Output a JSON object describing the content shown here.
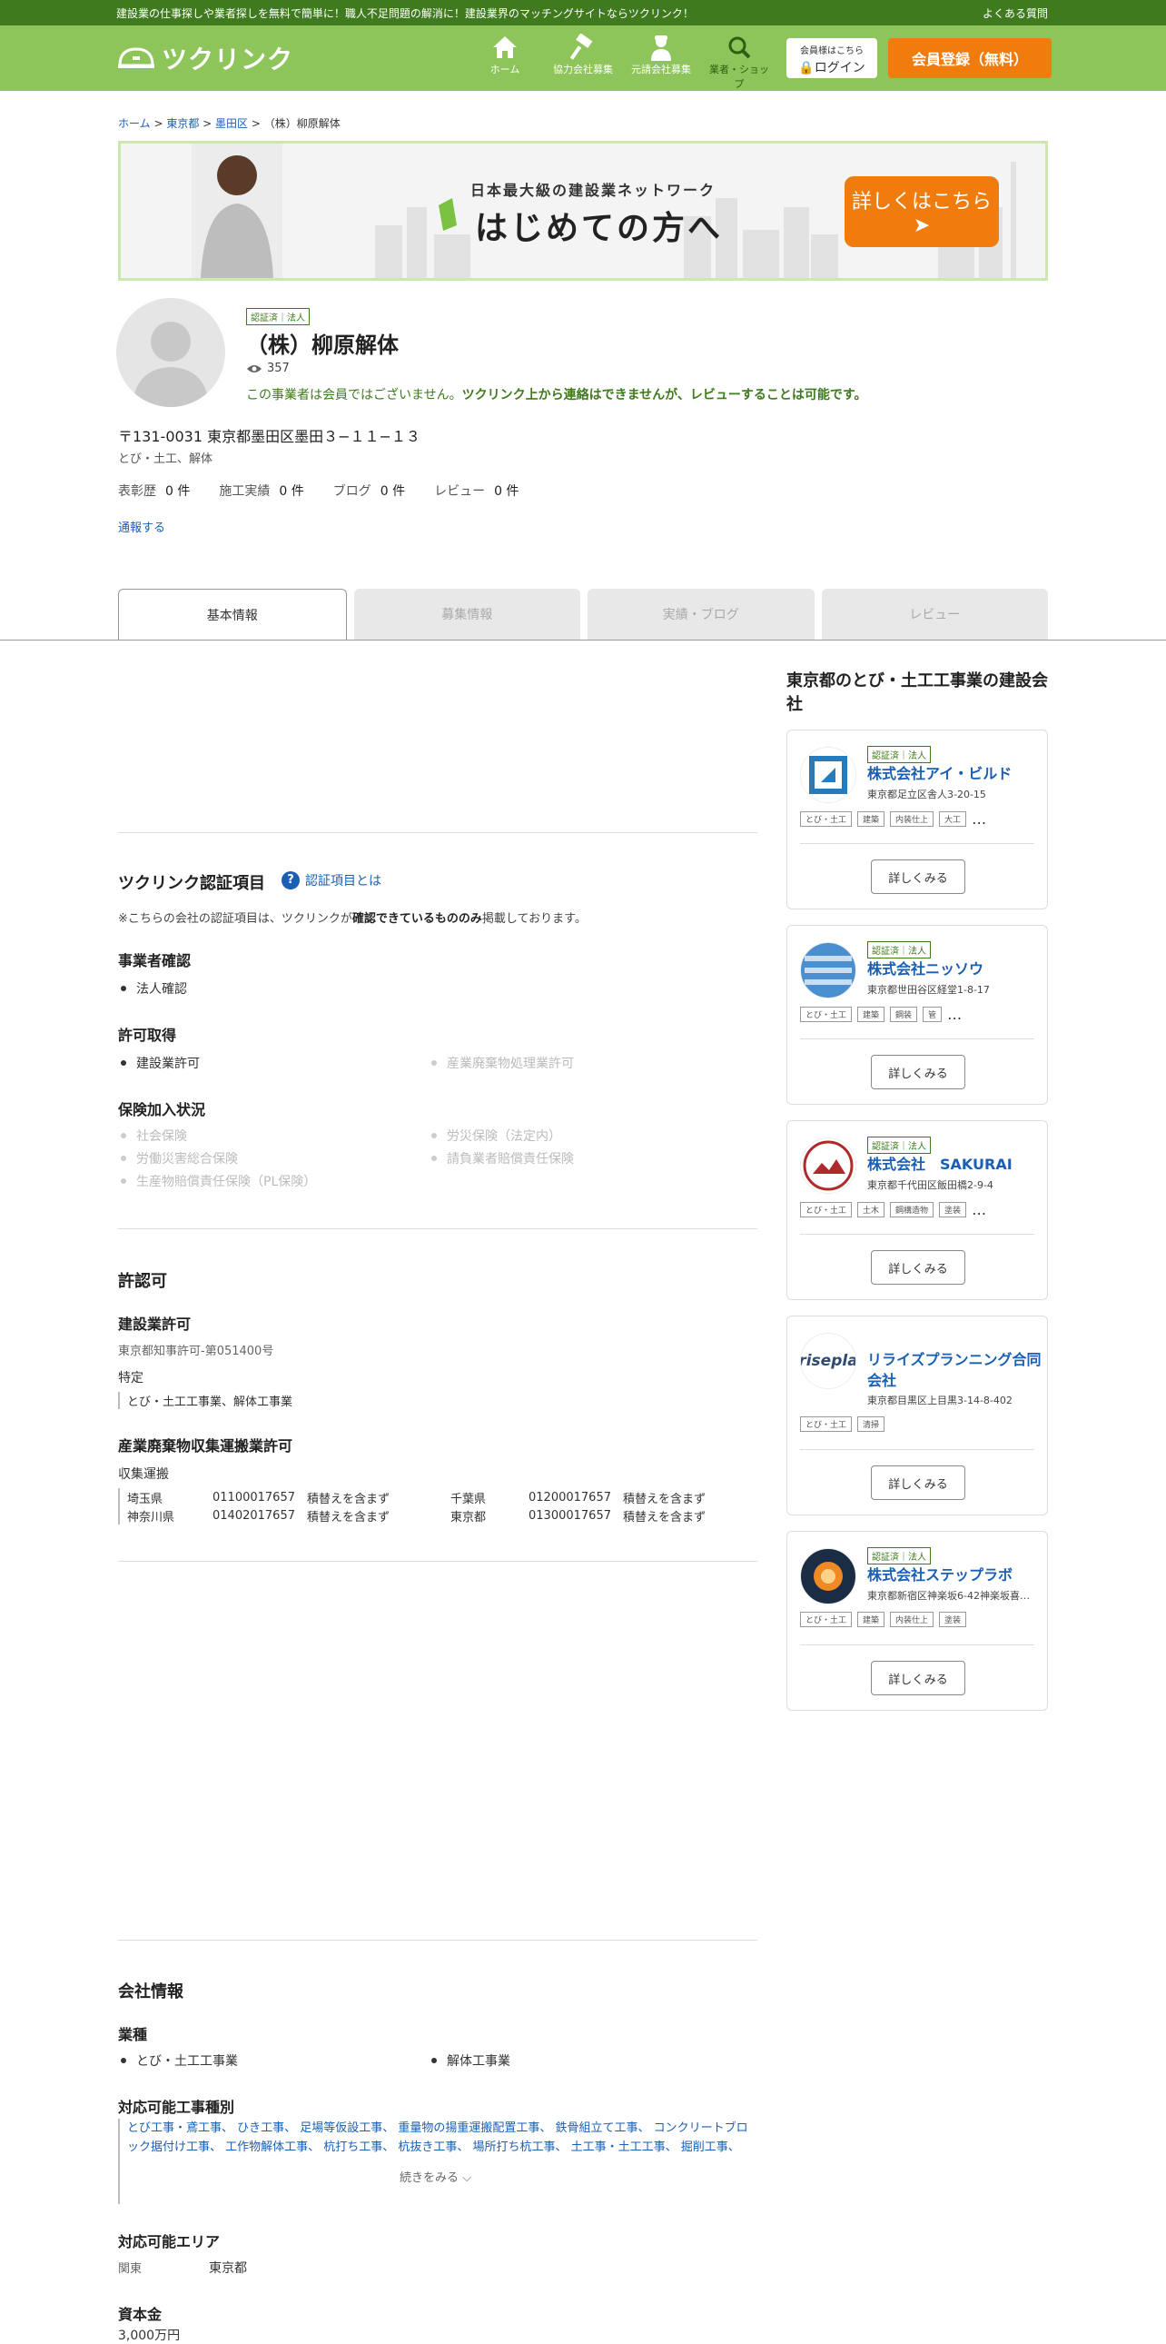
{
  "topbar": {
    "tagline": "建設業の仕事探しや業者探しを無料で簡単に！職人不足問題の解消に！建設業界のマッチングサイトならツクリンク！",
    "faq": "よくある質問"
  },
  "header": {
    "logo": "ツクリンク",
    "nav": [
      {
        "label": "ホーム",
        "icon": "home-icon"
      },
      {
        "label": "協力会社募集",
        "icon": "hammer-icon"
      },
      {
        "label": "元請会社募集",
        "icon": "worker-icon"
      },
      {
        "label": "業者・ショップ",
        "icon": "search-icon"
      }
    ],
    "login_top": "会員様はこちら",
    "login": "ログイン",
    "register": "会員登録（無料）"
  },
  "breadcrumb": {
    "home": "ホーム",
    "pref": "東京都",
    "city": "墨田区",
    "current": "（株）柳原解体"
  },
  "banner": {
    "sub": "日本最大級の建設業ネットワーク",
    "main": "はじめての方へ",
    "cta": "詳しくはこちら"
  },
  "company": {
    "badge": "認証済｜法人",
    "name": "（株）柳原解体",
    "views": "357",
    "notice_a": "この事業者は会員ではございません。",
    "notice_b": "ツクリンク上から連絡はできませんが、レビューすることは可能です。",
    "address": "〒131-0031 東京都墨田区墨田３−１１−１３",
    "categories": "とび・土工、解体",
    "stats": [
      {
        "label": "表彰歴",
        "value": "0 件"
      },
      {
        "label": "施工実績",
        "value": "0 件"
      },
      {
        "label": "ブログ",
        "value": "0 件"
      },
      {
        "label": "レビュー",
        "value": "0 件"
      }
    ],
    "report": "通報する"
  },
  "tabs": [
    "基本情報",
    "募集情報",
    "実績・ブログ",
    "レビュー"
  ],
  "cert": {
    "title": "ツクリンク認証項目",
    "help": "認証項目とは",
    "note_a": "※こちらの会社の認証項目は、ツクリンクが",
    "note_b": "確認できているもののみ",
    "note_c": "掲載しております。",
    "business_title": "事業者確認",
    "business": "法人確認",
    "permit_title": "許可取得",
    "permits": [
      "建設業許可",
      "産業廃棄物処理業許可"
    ],
    "insurance_title": "保険加入状況",
    "insurance": [
      "社会保険",
      "労災保険（法定内）",
      "労働災害総合保険",
      "請負業者賠償責任保険",
      "生産物賠償責任保険（PL保険）"
    ]
  },
  "license": {
    "title": "許認可",
    "construction_title": "建設業許可",
    "construction_no": "東京都知事許可-第051400号",
    "type": "特定",
    "works": "とび・土工工事業、解体工事業",
    "waste_title": "産業廃棄物収集運搬業許可",
    "waste_type": "収集運搬",
    "waste_rows": [
      [
        "埼玉県",
        "01100017657",
        "積替えを含まず",
        "千葉県",
        "01200017657",
        "積替えを含まず"
      ],
      [
        "神奈川県",
        "01402017657",
        "積替えを含まず",
        "東京都",
        "01300017657",
        "積替えを含まず"
      ]
    ]
  },
  "sidebar": {
    "title": "東京都のとび・土工工事業の建設会社",
    "detail": "詳しくみる",
    "cards": [
      {
        "badge": "認証済｜法人",
        "name": "株式会社アイ・ビルド",
        "address": "東京都足立区舎人3-20-15",
        "tags": [
          "とび・土工",
          "建築",
          "内装仕上",
          "大工"
        ],
        "more": "…"
      },
      {
        "badge": "認証済｜法人",
        "name": "株式会社ニッソウ",
        "address": "東京都世田谷区経堂1-8-17",
        "tags": [
          "とび・土工",
          "建築",
          "鋼装",
          "管"
        ],
        "more": "…"
      },
      {
        "badge": "認証済｜法人",
        "name": "株式会社　SAKURAI",
        "address": "東京都千代田区飯田橋2-9-4",
        "tags": [
          "とび・土工",
          "土木",
          "鋼構造物",
          "塗装"
        ],
        "more": "…"
      },
      {
        "badge": "",
        "name": "リライズプランニング合同会社",
        "address": "東京都目黒区上目黒3-14-8-402",
        "tags": [
          "とび・土工",
          "清掃"
        ],
        "more": ""
      },
      {
        "badge": "認証済｜法人",
        "name": "株式会社ステップラボ",
        "address": "東京都新宿区神楽坂6-42神楽坂喜…",
        "tags": [
          "とび・土工",
          "建築",
          "内装仕上",
          "塗装"
        ],
        "more": ""
      }
    ]
  },
  "company_info": {
    "title": "会社情報",
    "industry_title": "業種",
    "industries": [
      "とび・土工工事業",
      "解体工事業"
    ],
    "work_title": "対応可能工事種別",
    "works": "とび工事・鳶工事、 ひき工事、 足場等仮設工事、 重量物の揚重運搬配置工事、 鉄骨組立て工事、 コンクリートブロック据付け工事、 工作物解体工事、 杭打ち工事、 杭抜き工事、 場所打ち杭工事、 土工事・土工工事、 掘削工事、",
    "more": "続きをみる",
    "area_title": "対応可能エリア",
    "area_region": "関東",
    "area_pref": "東京都",
    "capital_title": "資本金",
    "capital": "3,000万円"
  }
}
